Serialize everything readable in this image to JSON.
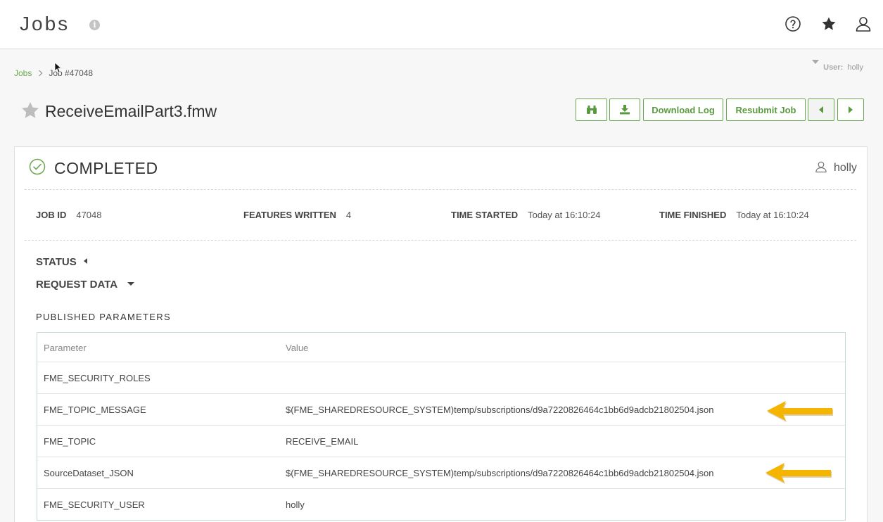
{
  "header": {
    "title": "Jobs",
    "info_icon": "info-icon",
    "icons": [
      "help-icon",
      "star-icon",
      "user-icon"
    ]
  },
  "breadcrumb": {
    "root": "Jobs",
    "current": "Job #47048"
  },
  "user_filter": {
    "label": "User:",
    "value": "holly"
  },
  "job": {
    "title": "ReceiveEmailPart3.fmw",
    "favorite": false
  },
  "toolbar": {
    "download_log_label": "Download Log",
    "resubmit_label": "Resubmit Job"
  },
  "summary": {
    "status": "COMPLETED",
    "owner": "holly",
    "job_id_label": "JOB ID",
    "job_id": "47048",
    "features_label": "FEATURES WRITTEN",
    "features": "4",
    "started_label": "TIME STARTED",
    "started": "Today at 16:10:24",
    "finished_label": "TIME FINISHED",
    "finished": "Today at 16:10:24"
  },
  "sections": {
    "status_label": "STATUS",
    "request_label": "REQUEST DATA"
  },
  "published_parameters": {
    "heading": "PUBLISHED PARAMETERS",
    "col_parameter": "Parameter",
    "col_value": "Value",
    "rows": [
      {
        "name": "FME_SECURITY_ROLES",
        "value": ""
      },
      {
        "name": "FME_TOPIC_MESSAGE",
        "value": "$(FME_SHAREDRESOURCE_SYSTEM)temp/subscriptions/d9a7220826464c1bb6d9adcb21802504.json"
      },
      {
        "name": "FME_TOPIC",
        "value": "RECEIVE_EMAIL"
      },
      {
        "name": "SourceDataset_JSON",
        "value": "$(FME_SHAREDRESOURCE_SYSTEM)temp/subscriptions/d9a7220826464c1bb6d9adcb21802504.json"
      },
      {
        "name": "FME_SECURITY_USER",
        "value": "holly"
      }
    ]
  },
  "colors": {
    "accent": "#6aa84f",
    "arrow": "#f5b400"
  }
}
